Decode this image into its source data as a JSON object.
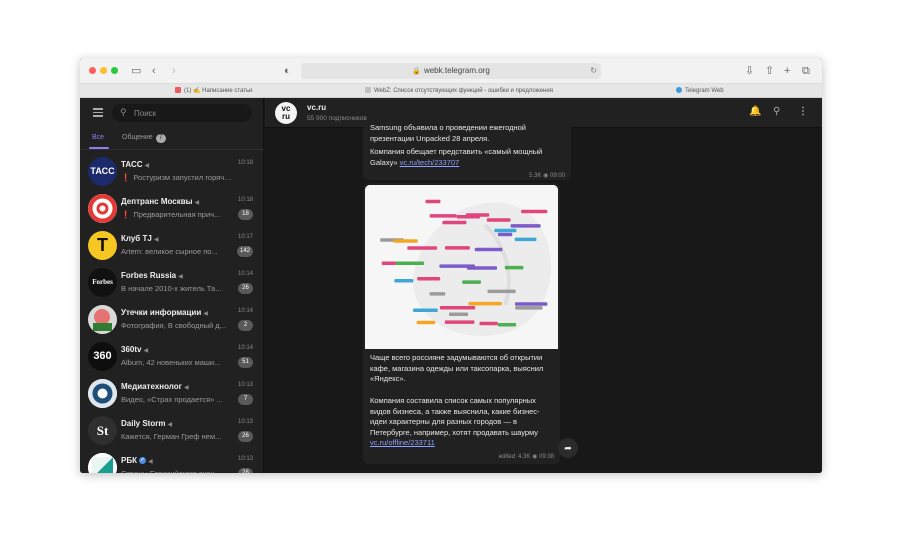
{
  "browser": {
    "url": "webk.telegram.org",
    "tabs": [
      {
        "label": "(1) ✍️ Написание статьи",
        "color": "#e85d5d"
      },
      {
        "label": "WebZ: Список отсутствующих функций - ошибки и предложения",
        "color": "#c0c0c0"
      },
      {
        "label": "Telegram Web",
        "color": "#3a9be0"
      }
    ]
  },
  "sidebar": {
    "search_placeholder": "Поиск",
    "filter_all": "Все",
    "filter_general": "Общение",
    "filter_general_count": "7",
    "chats": [
      {
        "name": "ТАСС",
        "time": "10:18",
        "preview": "Ростуризм запустил горячу...",
        "alert": "❗",
        "badge": "",
        "avatar_text": "ТАСС",
        "avatar_bg": "#1c2a6b"
      },
      {
        "name": "Дептранс Москвы",
        "time": "10:18",
        "preview": "Предварительная прич...",
        "alert": "❗",
        "badge": "18",
        "avatar_text": "",
        "avatar_bg": "#ffffff"
      },
      {
        "name": "Клуб TJ",
        "time": "10:17",
        "preview": "Artem: великое сырное по...",
        "alert": "",
        "badge": "142",
        "avatar_text": "T",
        "avatar_bg": "#f6c622"
      },
      {
        "name": "Forbes Russia",
        "time": "10:14",
        "preview": "В начале 2010-х житель Та...",
        "alert": "",
        "badge": "26",
        "avatar_text": "Forbes",
        "avatar_bg": "#111111"
      },
      {
        "name": "Утечки информации",
        "time": "10:14",
        "preview": "Фотография, В свободный д...",
        "alert": "",
        "badge": "2",
        "avatar_text": "",
        "avatar_bg": "#2e5e3a"
      },
      {
        "name": "360tv",
        "time": "10:14",
        "preview": "Album, 42 новеньких маши...",
        "alert": "",
        "badge": "51",
        "avatar_text": "360",
        "avatar_bg": "#0e0e0e"
      },
      {
        "name": "Медиатехнолог",
        "time": "10:13",
        "preview": "Видео, «Страх продается» ...",
        "alert": "",
        "badge": "7",
        "avatar_text": "",
        "avatar_bg": "#dfe6ee"
      },
      {
        "name": "Daily Storm",
        "time": "10:13",
        "preview": "Кажется, Герман Греф нем...",
        "alert": "",
        "badge": "26",
        "avatar_text": "St",
        "avatar_bg": "#2f2f2f"
      },
      {
        "name": "РБК",
        "time": "10:13",
        "preview": "Страны Евразийского экон...",
        "alert": "",
        "badge": "28",
        "avatar_text": "",
        "avatar_bg": "#ffffff",
        "verified": true
      }
    ]
  },
  "channel": {
    "avatar_text_1": "vc",
    "avatar_text_2": "ru",
    "title": "vc.ru",
    "subscribers": "55 900 подписчиков"
  },
  "messages": {
    "first": {
      "text_cut": "Samsung объявила о проведении ежегодной презентации Unpacked 28 апреля.",
      "text_2": "Компания обещает представить «самый мощный Galaxy»",
      "link": "vc.ru/tech/233707",
      "views": "5.3K",
      "time": "09:00"
    },
    "second": {
      "text_1": "Чаще всего россияне задумываются об открытии кафе, магазина одежды или таксопарка, выяснил «Яндекс».",
      "text_2": "Компания составила список самых популярных видов бизнеса, а также выяснила, какие бизнес-идеи характерны для разных городов — в Петербурге, например, хотят продавать шаурму",
      "link": "vc.ru/offline/233711",
      "edited": "edited",
      "views": "4.3K",
      "time": "09:38"
    }
  },
  "map_labels": [
    {
      "color": "#e0457b"
    },
    {
      "color": "#e0457b"
    },
    {
      "color": "#7b5cc9"
    },
    {
      "color": "#3da8d6"
    },
    {
      "color": "#e0457b"
    },
    {
      "color": "#4caf50"
    },
    {
      "color": "#f5a623"
    },
    {
      "color": "#9b9b9b"
    },
    {
      "color": "#e0457b"
    },
    {
      "color": "#7b5cc9"
    },
    {
      "color": "#3da8d6"
    },
    {
      "color": "#e0457b"
    },
    {
      "color": "#9b9b9b"
    },
    {
      "color": "#4caf50"
    },
    {
      "color": "#e0457b"
    },
    {
      "color": "#7b5cc9"
    },
    {
      "color": "#f5a623"
    },
    {
      "color": "#e0457b"
    },
    {
      "color": "#3da8d6"
    },
    {
      "color": "#9b9b9b"
    },
    {
      "color": "#e0457b"
    },
    {
      "color": "#7b5cc9"
    },
    {
      "color": "#4caf50"
    },
    {
      "color": "#e0457b"
    },
    {
      "color": "#9b9b9b"
    },
    {
      "color": "#e0457b"
    },
    {
      "color": "#3da8d6"
    },
    {
      "color": "#7b5cc9"
    },
    {
      "color": "#e0457b"
    },
    {
      "color": "#f5a623"
    },
    {
      "color": "#e0457b"
    },
    {
      "color": "#9b9b9b"
    },
    {
      "color": "#7b5cc9"
    },
    {
      "color": "#e0457b"
    },
    {
      "color": "#4caf50"
    },
    {
      "color": "#e0457b"
    }
  ],
  "colors": {
    "accent": "#8d7ff0",
    "link": "#8fa2ff"
  }
}
